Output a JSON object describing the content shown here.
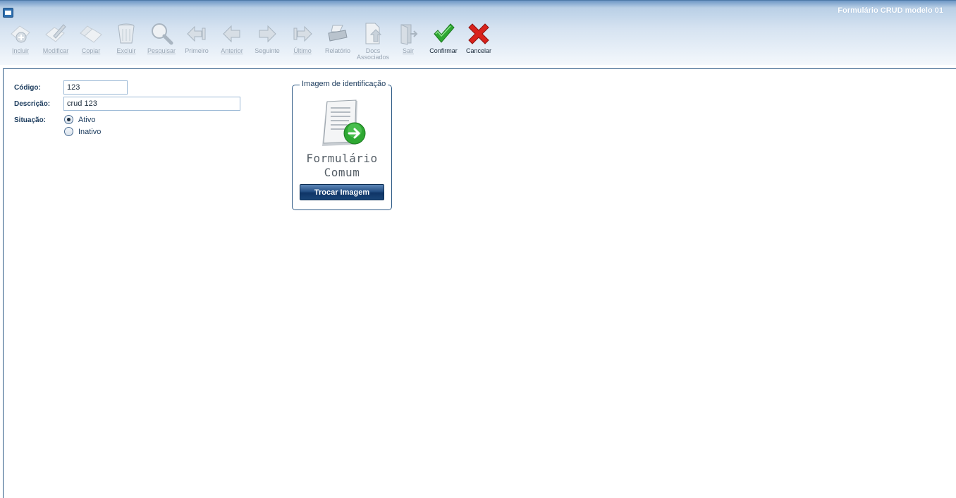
{
  "window": {
    "title": "Formulário CRUD modelo 01"
  },
  "toolbar": {
    "items": [
      {
        "label": "Incluir",
        "icon": "add-document-icon",
        "enabled": false
      },
      {
        "label": "Modificar",
        "icon": "edit-pencil-icon",
        "enabled": false
      },
      {
        "label": "Copiar",
        "icon": "copy-icon",
        "enabled": false
      },
      {
        "label": "Excluir",
        "icon": "trash-icon",
        "enabled": false
      },
      {
        "label": "Pesquisar",
        "icon": "magnifier-icon",
        "enabled": false
      },
      {
        "label": "Primeiro",
        "icon": "first-record-icon",
        "enabled": false
      },
      {
        "label": "Anterior",
        "icon": "previous-arrow-icon",
        "enabled": false
      },
      {
        "label": "Seguinte",
        "icon": "next-arrow-icon",
        "enabled": false
      },
      {
        "label": "Último",
        "icon": "last-record-icon",
        "enabled": false
      },
      {
        "label": "Relatório",
        "icon": "printer-icon",
        "enabled": false
      },
      {
        "label": "Docs\nAssociados",
        "icon": "attached-docs-icon",
        "enabled": false
      },
      {
        "label": "Sair",
        "icon": "exit-door-icon",
        "enabled": false
      },
      {
        "label": "Confirmar",
        "icon": "check-icon",
        "enabled": true
      },
      {
        "label": "Cancelar",
        "icon": "cancel-x-icon",
        "enabled": true
      }
    ]
  },
  "form": {
    "codigo_label": "Código:",
    "codigo_value": "123",
    "descricao_label": "Descrição:",
    "descricao_value": "crud 123",
    "situacao_label": "Situação:",
    "situacao_options": [
      {
        "label": "Ativo",
        "checked": true
      },
      {
        "label": "Inativo",
        "checked": false
      }
    ]
  },
  "image_panel": {
    "legend": "Imagem de identificação",
    "caption_line1": "Formulário",
    "caption_line2": "Comum",
    "button_label": "Trocar Imagem",
    "icon": "document-green-arrow-icon"
  },
  "colors": {
    "accent": "#2e5a86",
    "confirm_green": "#2ea832",
    "cancel_red": "#d9221c",
    "button_dark": "#0f3567"
  }
}
